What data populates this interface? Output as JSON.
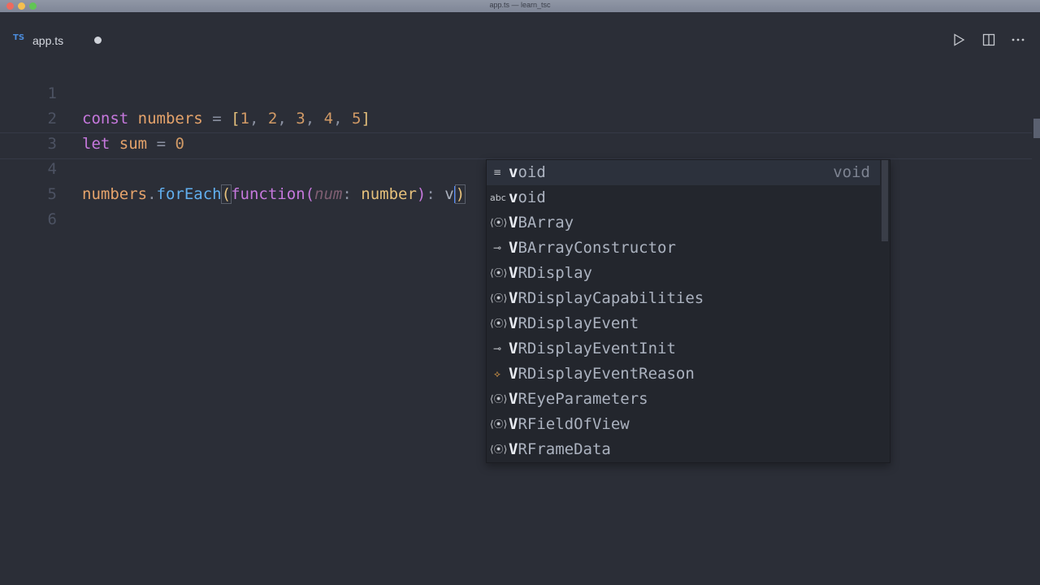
{
  "window": {
    "title": "app.ts — learn_tsc"
  },
  "tab": {
    "icon": "typescript-icon",
    "icon_text": "TS",
    "label": "app.ts"
  },
  "toolbar": {
    "run_icon": "play-icon",
    "split_icon": "split-editor-icon",
    "more_icon": "more-icon"
  },
  "editor": {
    "line_numbers": [
      "1",
      "2",
      "3",
      "4",
      "5",
      "6"
    ],
    "line1": {
      "kw": "const",
      "name": "numbers",
      "eq": "=",
      "open": "[",
      "v1": "1",
      "v2": "2",
      "v3": "3",
      "v4": "4",
      "v5": "5",
      "close": "]",
      "comma": ","
    },
    "line2": {
      "kw": "let",
      "name": "sum",
      "eq": "=",
      "value": "0"
    },
    "line4": {
      "obj": "numbers",
      "dot": ".",
      "method": "forEach",
      "open": "(",
      "fkw": "function",
      "popen": "(",
      "param": "num",
      "colon": ":",
      "ptype": "number",
      "pclose": ")",
      "rcolon": ":",
      "typed": "v",
      "close": ")"
    }
  },
  "suggest": {
    "items": [
      {
        "icon": "keyword-icon",
        "glyph": "≡",
        "match": "v",
        "rest": "oid",
        "detail": "void"
      },
      {
        "icon": "text-icon",
        "glyph": "abc",
        "match": "v",
        "rest": "oid",
        "detail": ""
      },
      {
        "icon": "variable-icon",
        "glyph": "⟨⦿⟩",
        "match": "V",
        "rest": "BArray",
        "detail": ""
      },
      {
        "icon": "interface-icon",
        "glyph": "⊸",
        "match": "V",
        "rest": "BArrayConstructor",
        "detail": ""
      },
      {
        "icon": "variable-icon",
        "glyph": "⟨⦿⟩",
        "match": "V",
        "rest": "RDisplay",
        "detail": ""
      },
      {
        "icon": "variable-icon",
        "glyph": "⟨⦿⟩",
        "match": "V",
        "rest": "RDisplayCapabilities",
        "detail": ""
      },
      {
        "icon": "variable-icon",
        "glyph": "⟨⦿⟩",
        "match": "V",
        "rest": "RDisplayEvent",
        "detail": ""
      },
      {
        "icon": "interface-icon",
        "glyph": "⊸",
        "match": "V",
        "rest": "RDisplayEventInit",
        "detail": ""
      },
      {
        "icon": "enum-icon",
        "glyph": "⟡",
        "match": "V",
        "rest": "RDisplayEventReason",
        "detail": ""
      },
      {
        "icon": "variable-icon",
        "glyph": "⟨⦿⟩",
        "match": "V",
        "rest": "REyeParameters",
        "detail": ""
      },
      {
        "icon": "variable-icon",
        "glyph": "⟨⦿⟩",
        "match": "V",
        "rest": "RFieldOfView",
        "detail": ""
      },
      {
        "icon": "variable-icon",
        "glyph": "⟨⦿⟩",
        "match": "V",
        "rest": "RFrameData",
        "detail": ""
      }
    ]
  }
}
